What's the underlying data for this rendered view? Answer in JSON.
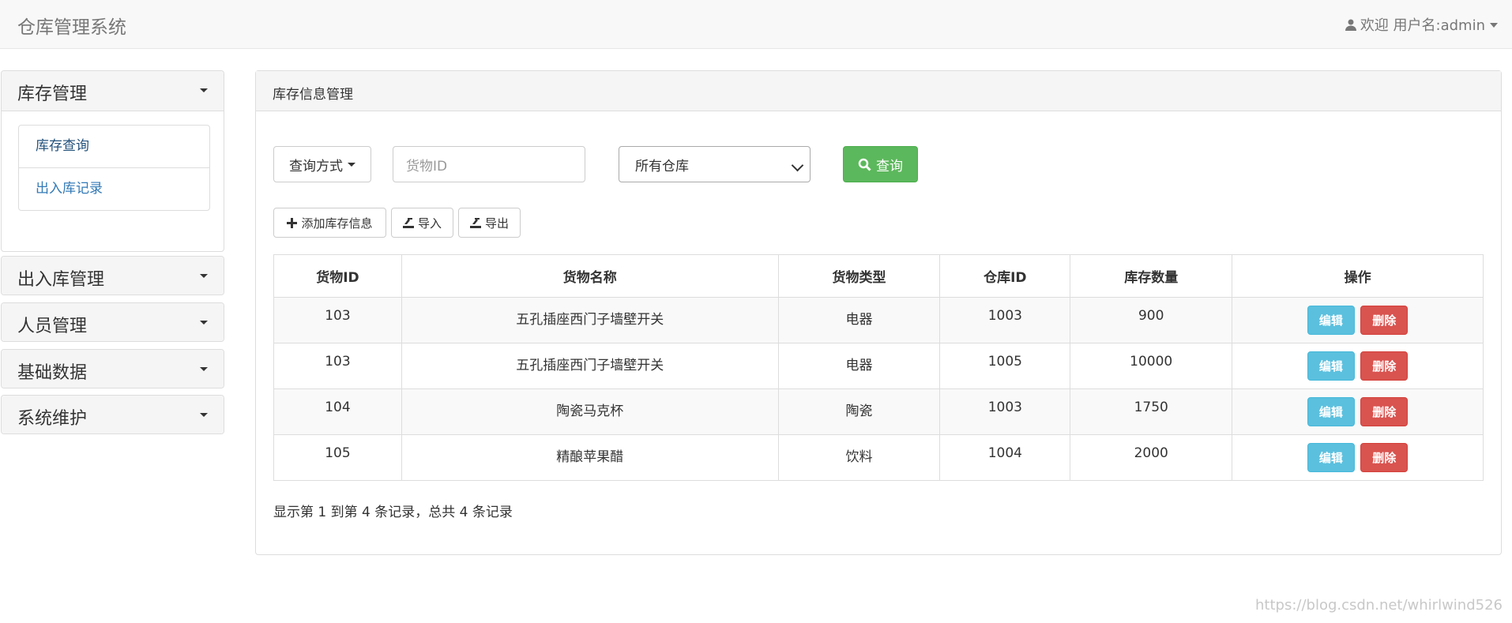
{
  "navbar": {
    "brand": "仓库管理系统",
    "user_label": "欢迎 用户名:admin"
  },
  "sidebar": {
    "groups": [
      {
        "label": "库存管理",
        "items": [
          "库存查询",
          "出入库记录"
        ]
      },
      {
        "label": "出入库管理"
      },
      {
        "label": "人员管理"
      },
      {
        "label": "基础数据"
      },
      {
        "label": "系统维护"
      }
    ]
  },
  "main": {
    "title": "库存信息管理",
    "query_mode_label": "查询方式",
    "goods_id_placeholder": "货物ID",
    "warehouse_select_value": "所有仓库",
    "search_label": "查询",
    "add_label": "添加库存信息",
    "import_label": "导入",
    "export_label": "导出",
    "table": {
      "headers": [
        "货物ID",
        "货物名称",
        "货物类型",
        "仓库ID",
        "库存数量",
        "操作"
      ],
      "rows": [
        [
          "103",
          "五孔插座西门子墙壁开关",
          "电器",
          "1003",
          "900"
        ],
        [
          "103",
          "五孔插座西门子墙壁开关",
          "电器",
          "1005",
          "10000"
        ],
        [
          "104",
          "陶瓷马克杯",
          "陶瓷",
          "1003",
          "1750"
        ],
        [
          "105",
          "精酿苹果醋",
          "饮料",
          "1004",
          "2000"
        ]
      ],
      "edit_label": "编辑",
      "delete_label": "删除"
    },
    "pagination_info": "显示第 1 到第 4 条记录，总共 4 条记录"
  },
  "watermark": "https://blog.csdn.net/whirlwind526"
}
